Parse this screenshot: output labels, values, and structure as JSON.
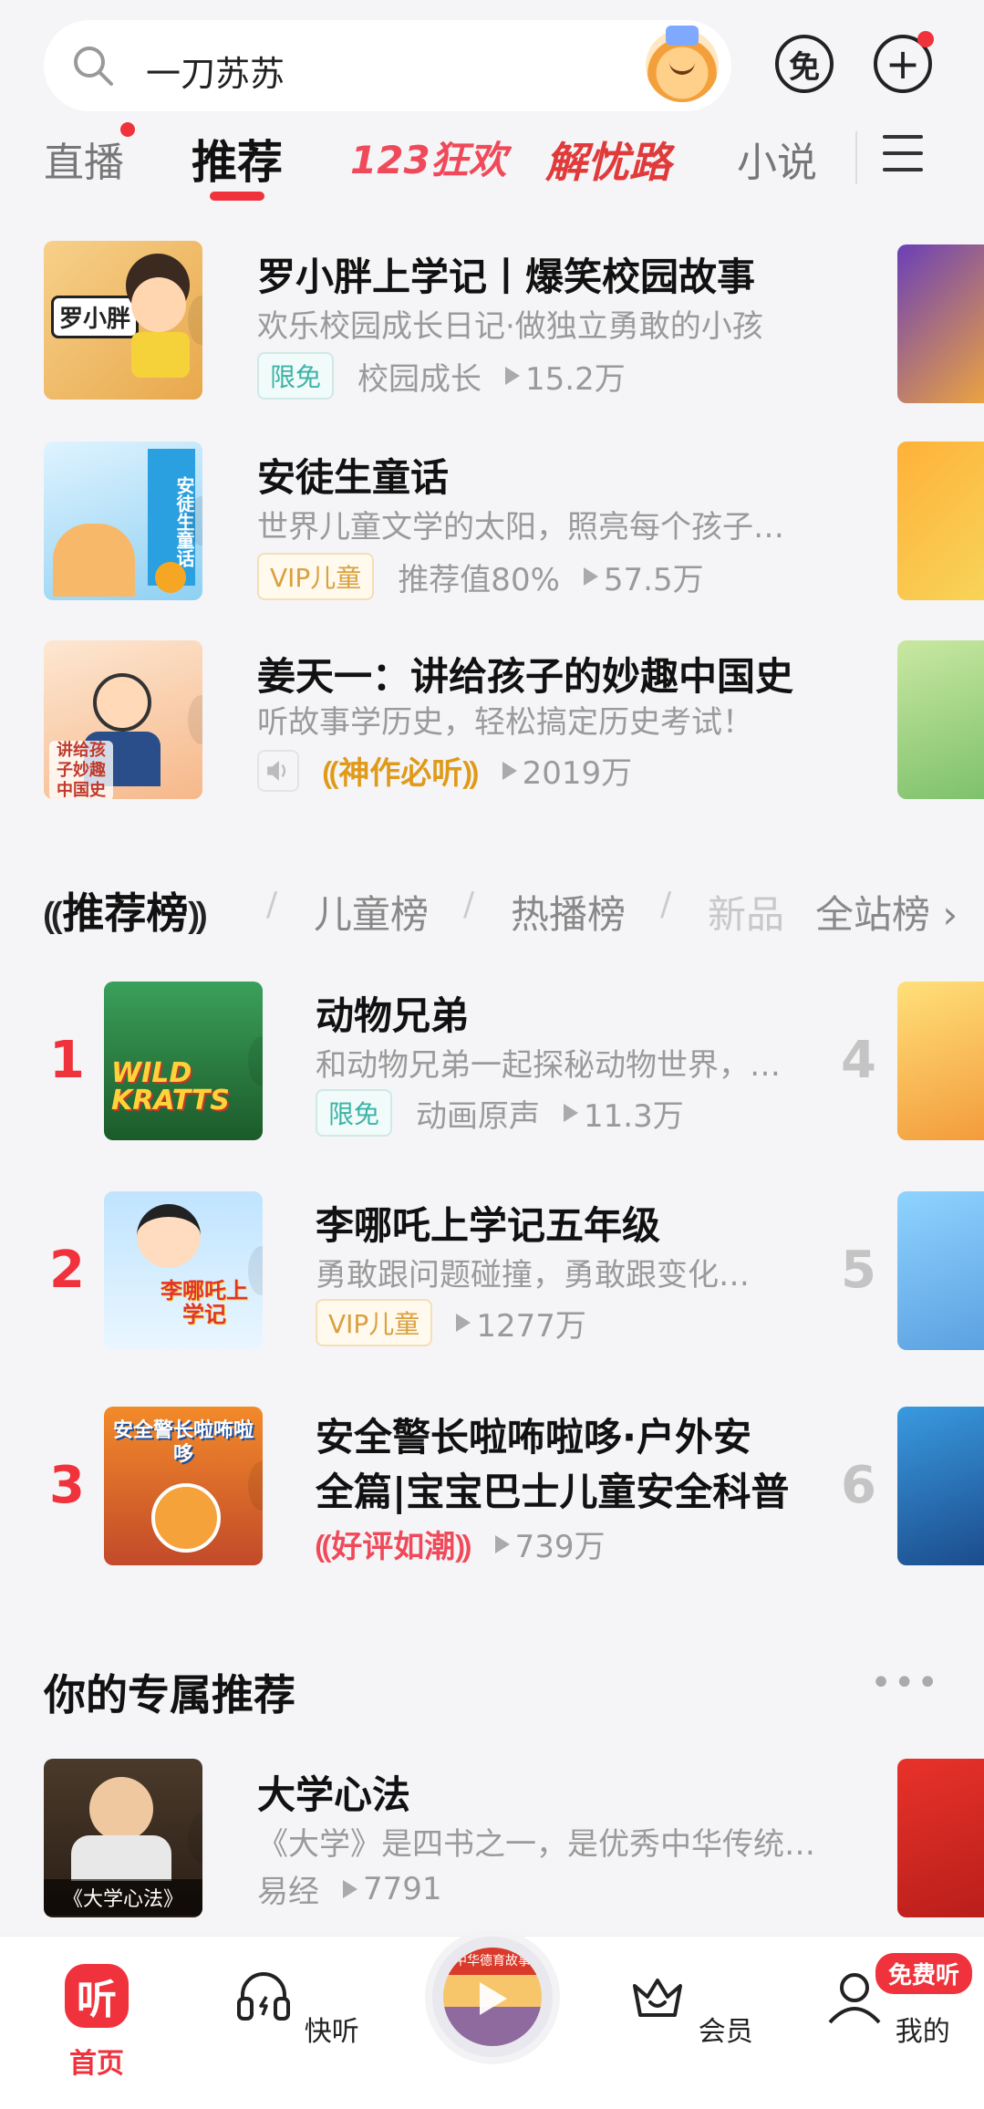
{
  "header": {
    "search_value": "一刀苏苏",
    "free_button_label": "免",
    "add_button_label": "+"
  },
  "tabs": [
    {
      "label": "直播",
      "has_dot": true
    },
    {
      "label": "推荐",
      "active": true
    },
    {
      "label": "123狂欢"
    },
    {
      "label": "解忧路"
    },
    {
      "label": "小说"
    }
  ],
  "recommend_list": [
    {
      "title": "罗小胖上学记丨爆笑校园故事",
      "subtitle": "欢乐校园成长日记·做独立勇敢的小孩",
      "tag": "限免",
      "category": "校园成长",
      "plays": "15.2万",
      "cover_text": "罗小胖"
    },
    {
      "title": "安徒生童话",
      "subtitle": "世界儿童文学的太阳，照亮每个孩子…",
      "tag": "VIP儿童",
      "category": "推荐值80%",
      "plays": "57.5万",
      "cover_text": "安徒生童话"
    },
    {
      "title": "姜天一：讲给孩子的妙趣中国史",
      "subtitle": "听故事学历史，轻松搞定历史考试！",
      "badge": "神作必听",
      "plays": "2019万",
      "cover_text": "讲给孩子妙趣中国史"
    }
  ],
  "ranking": {
    "tabs": [
      "推荐榜",
      "儿童榜",
      "热播榜",
      "新品",
      "全站榜"
    ],
    "items": [
      {
        "rank": "1",
        "title": "动物兄弟",
        "subtitle": "和动物兄弟一起探秘动物世界，…",
        "tag": "限免",
        "category": "动画原声",
        "plays": "11.3万",
        "cover_text": "WILD KRATTS"
      },
      {
        "rank": "2",
        "title": "李哪吒上学记五年级",
        "subtitle": "勇敢跟问题碰撞，勇敢跟变化…",
        "tag": "VIP儿童",
        "plays": "1277万",
        "cover_text": "李哪吒上学记"
      },
      {
        "rank": "3",
        "title_line1": "安全警长啦咘啦哆·户外安",
        "title_line2": "全篇|宝宝巴士儿童安全科普",
        "badge": "好评如潮",
        "plays": "739万",
        "cover_text": "安全警长啦咘啦哆"
      }
    ],
    "side_ranks": [
      "4",
      "5",
      "6"
    ]
  },
  "exclusive": {
    "title": "你的专属推荐",
    "more": "•••",
    "item": {
      "title": "大学心法",
      "subtitle": "《大学》是四书之一，是优秀中华传统…",
      "category": "易经",
      "plays": "7791",
      "cover_text": "《大学心法》"
    }
  },
  "bottom_nav": {
    "items": [
      {
        "label": "首页",
        "icon_text": "听"
      },
      {
        "label": "快听"
      },
      {
        "label": "会员"
      },
      {
        "label": "我的"
      }
    ],
    "free_pill": "免费听",
    "disc_label": "中华德育故事"
  },
  "colors": {
    "accent": "#f0323c",
    "free_tag": "#3bb3a6",
    "vip_tag": "#d9a13e",
    "gold_badge": "#e09a1a"
  }
}
